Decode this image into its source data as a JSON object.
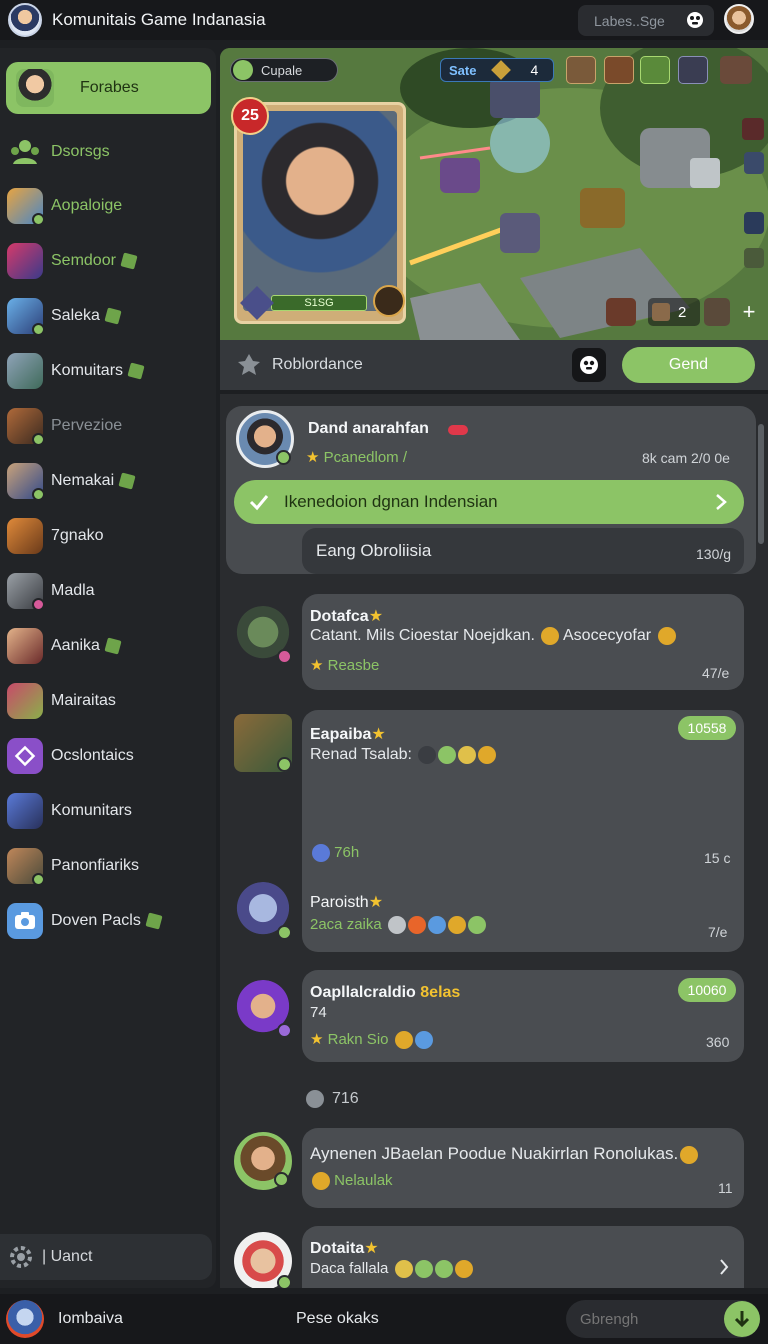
{
  "app": {
    "title": "Komunitais Game Indanasia",
    "search_placeholder": "Labes..Sge"
  },
  "sidebar": {
    "active_label": "Forabes",
    "items": [
      {
        "label": "Dsorsgs",
        "color": "#8cc466",
        "icon": "community-icon"
      },
      {
        "label": "Aopaloige",
        "color": "#8cc466"
      },
      {
        "label": "Semdoor",
        "color": "#8cc466"
      },
      {
        "label": "Saleka",
        "color": "#e3e6ea"
      },
      {
        "label": "Komuitars",
        "color": "#e3e6ea"
      },
      {
        "label": "Pervezioe",
        "color": "#8a9096"
      },
      {
        "label": "Nemakai",
        "color": "#e3e6ea"
      },
      {
        "label": "7gnako",
        "color": "#e3e6ea"
      },
      {
        "label": "Madla",
        "color": "#e3e6ea"
      },
      {
        "label": "Aanika",
        "color": "#e3e6ea"
      },
      {
        "label": "Mairaitas",
        "color": "#e3e6ea"
      },
      {
        "label": "Ocslontaics",
        "color": "#e3e6ea"
      },
      {
        "label": "Komunitars",
        "color": "#e3e6ea"
      },
      {
        "label": "Panonfiariks",
        "color": "#e3e6ea"
      },
      {
        "label": "Doven Pacls",
        "color": "#e3e6ea"
      }
    ],
    "bottom_label": "| Uanct"
  },
  "game": {
    "player_name": "Cupale",
    "score_label": "Sate",
    "score_value": "4",
    "hero_level": "25",
    "hero_hp": "S1SG",
    "unit_count": "2",
    "bar_title": "Roblordance",
    "send_button": "Gend"
  },
  "chat": {
    "pinned": {
      "name": "Dand anarahfan",
      "sub": "Pcanedlom /",
      "time": "8k cam 2/0 0e",
      "highlight": "Ikenedoion dgnan Indensian",
      "reply": "Eang Obroliisia",
      "reply_time": "130/g"
    },
    "messages": [
      {
        "name": "Dotafca",
        "text": "Catant. Mils Cioestar Noejdkan.",
        "text2": "Asocecyofar",
        "sub": "Reasbe",
        "time": "47/e"
      },
      {
        "name": "Eapaiba",
        "text": "Renad Tsalab:",
        "badge": "10558",
        "extra": "76h",
        "time": "15 c"
      },
      {
        "name": "Paroisth",
        "sub": "2aca zaika",
        "time": "7/e"
      },
      {
        "name": "Oapllalcraldio",
        "name_accent": "8elas",
        "text": "74",
        "sub": "Rakn Sio",
        "badge": "10060",
        "time": "360"
      },
      {
        "name": "",
        "text": "716"
      },
      {
        "name": "",
        "text": "Aynenen JBaelan Poodue Nuakirrlan Ronolukas.",
        "sub": "Nelaulak",
        "time": "11"
      },
      {
        "name": "Dotaita",
        "sub": "Daca fallala"
      }
    ]
  },
  "bottom": {
    "user_label": "Iombaiva",
    "center_label": "Pese okaks",
    "input_placeholder": "Gbrengh"
  }
}
